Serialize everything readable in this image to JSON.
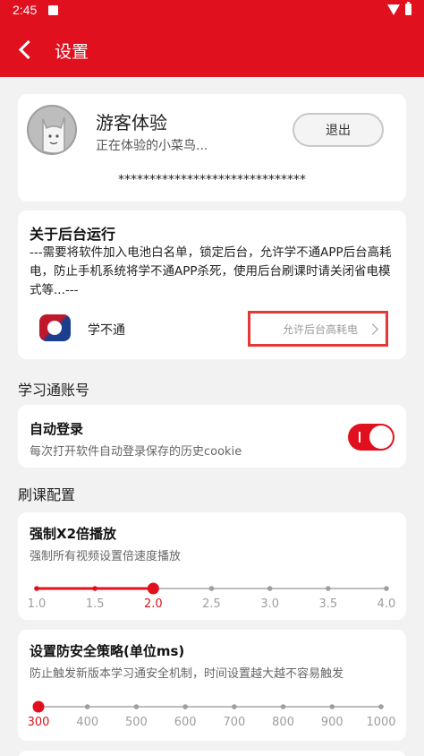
{
  "status_bar": {
    "time": "2:45"
  },
  "app_bar": {
    "title": "设置"
  },
  "user": {
    "name": "游客体验",
    "subtitle": "正在体验的小菜鸟...",
    "logout_label": "退出",
    "masked_id": "******************************"
  },
  "background_run": {
    "heading": "关于后台运行",
    "description": "---需要将软件加入电池白名单，锁定后台，允许学不通APP后台高耗电，防止手机系统将学不通APP杀死，使用后台刷课时请关闭省电模式等...---",
    "app_name": "学不通",
    "allow_label": "允许后台高耗电"
  },
  "account_section": {
    "heading": "学习通账号",
    "auto_login": {
      "title": "自动登录",
      "description": "每次打开软件自动登录保存的历史cookie",
      "enabled": true
    }
  },
  "course_section": {
    "heading": "刷课配置",
    "speed": {
      "title": "强制X2倍播放",
      "description": "强制所有视频设置倍速度播放",
      "ticks": [
        "1.0",
        "1.5",
        "2.0",
        "2.5",
        "3.0",
        "3.5",
        "4.0"
      ],
      "selected": "2.0"
    },
    "security": {
      "title": "设置防安全策略(单位ms)",
      "description": "防止触发新版本学习通安全机制，时间设置越大越不容易触发",
      "ticks": [
        "300",
        "400",
        "500",
        "600",
        "700",
        "800",
        "900",
        "1000"
      ],
      "selected": "300"
    }
  },
  "colors": {
    "accent": "#e0101e",
    "highlight_border": "#e53935"
  },
  "icons": [
    "chevron-left-icon",
    "chevron-right-icon",
    "wifi-icon",
    "battery-icon",
    "notification-icon",
    "avatar",
    "app-logo"
  ]
}
